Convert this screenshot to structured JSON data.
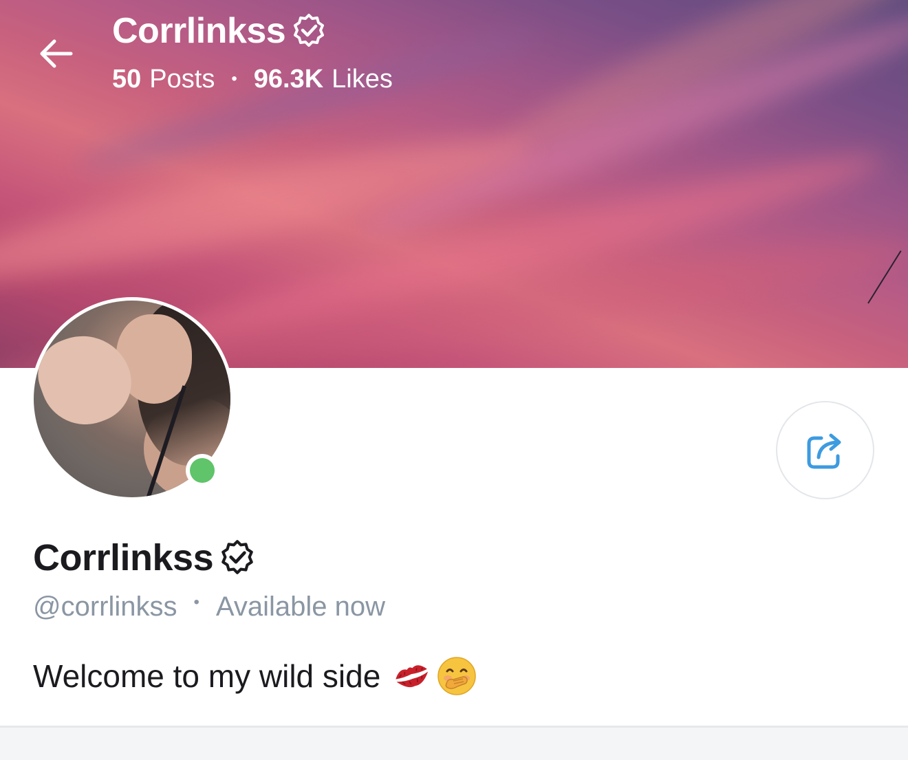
{
  "header": {
    "title": "Corrlinkss",
    "posts_count": "50",
    "posts_label": "Posts",
    "separator": "•",
    "likes_count": "96.3K",
    "likes_label": "Likes"
  },
  "profile": {
    "name": "Corrlinkss",
    "handle": "@corrlinkss",
    "separator": "•",
    "status": "Available now",
    "bio": "Welcome to my wild side",
    "online": true
  },
  "icons": {
    "back": "arrow-left-icon",
    "verified": "verified-badge-icon",
    "share": "share-icon",
    "bio_emojis": [
      "kiss-mark-icon",
      "hand-over-mouth-emoji-icon"
    ]
  },
  "colors": {
    "accent": "#3d9be0",
    "online": "#5fc46a",
    "muted_text": "#8a96a3",
    "primary_text": "#1b1b1f"
  }
}
